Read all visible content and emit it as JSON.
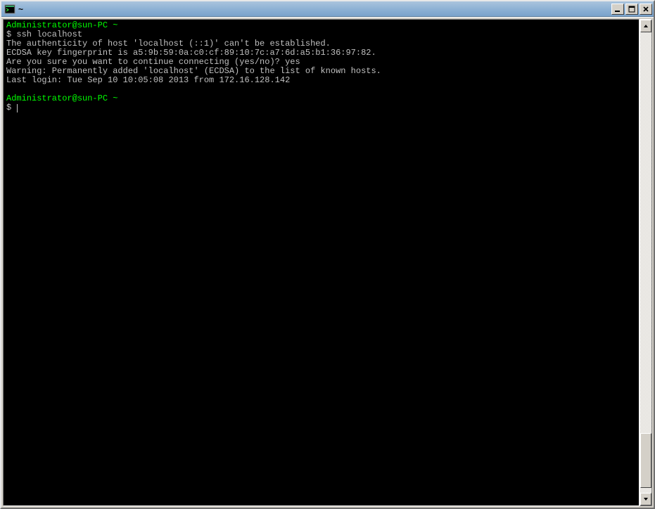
{
  "titlebar": {
    "title": "~"
  },
  "terminal": {
    "prompt1_user": "Administrator@sun-PC ~",
    "prompt1_cmd": "$ ssh localhost",
    "out1": "The authenticity of host 'localhost (::1)' can't be established.",
    "out2": "ECDSA key fingerprint is a5:9b:59:0a:c0:cf:89:10:7c:a7:6d:a5:b1:36:97:82.",
    "out3": "Are you sure you want to continue connecting (yes/no)? yes",
    "out4": "Warning: Permanently added 'localhost' (ECDSA) to the list of known hosts.",
    "out5": "Last login: Tue Sep 10 10:05:08 2013 from 172.16.128.142",
    "prompt2_user": "Administrator@sun-PC ~",
    "prompt2_cmd": "$ "
  },
  "scrollbar": {
    "thumb_top_pct": 87,
    "thumb_height_pct": 12
  }
}
